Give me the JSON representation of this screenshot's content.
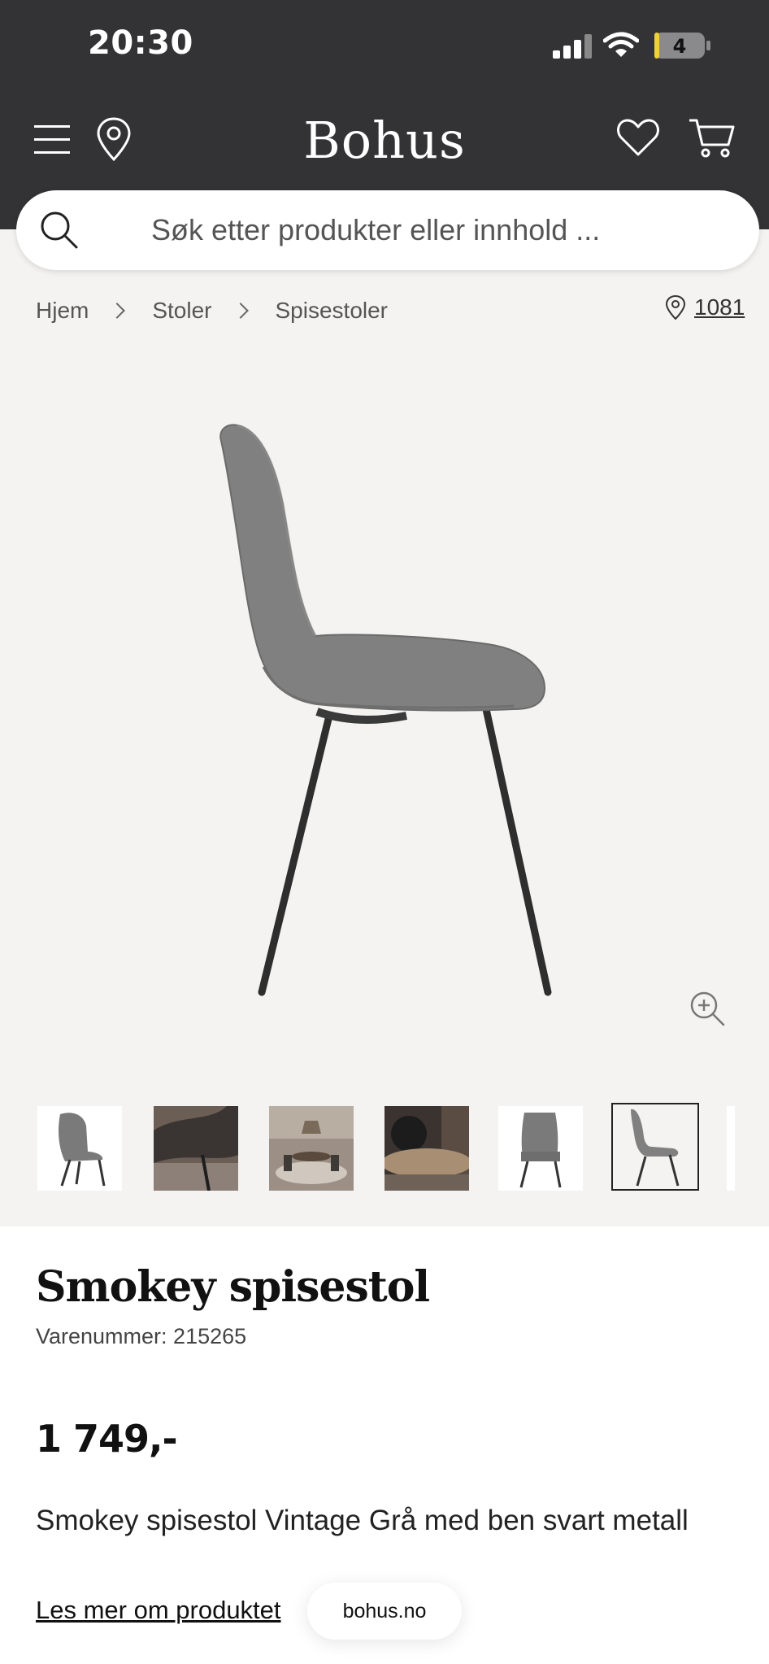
{
  "status_bar": {
    "time": "20:30",
    "battery_level": "4"
  },
  "header": {
    "logo": "Bohus"
  },
  "search": {
    "placeholder": "Søk etter produkter eller innhold ..."
  },
  "breadcrumb": {
    "items": [
      "Hjem",
      "Stoler",
      "Spisestoler"
    ]
  },
  "store": {
    "label": "1081"
  },
  "product": {
    "title": "Smokey spisestol",
    "sku": "Varenummer: 215265",
    "price": "1 749,-",
    "description": "Smokey spisestol Vintage Grå med ben svart metall",
    "more_link": "Les mer om produktet"
  },
  "gallery": {
    "count": 7,
    "selected_index": 5
  },
  "browser": {
    "domain": "bohus.no"
  },
  "colors": {
    "header_bg": "#333336",
    "page_bg": "#f4f3f1",
    "chair_upholstery": "#808080",
    "chair_legs": "#2e2e2e"
  }
}
